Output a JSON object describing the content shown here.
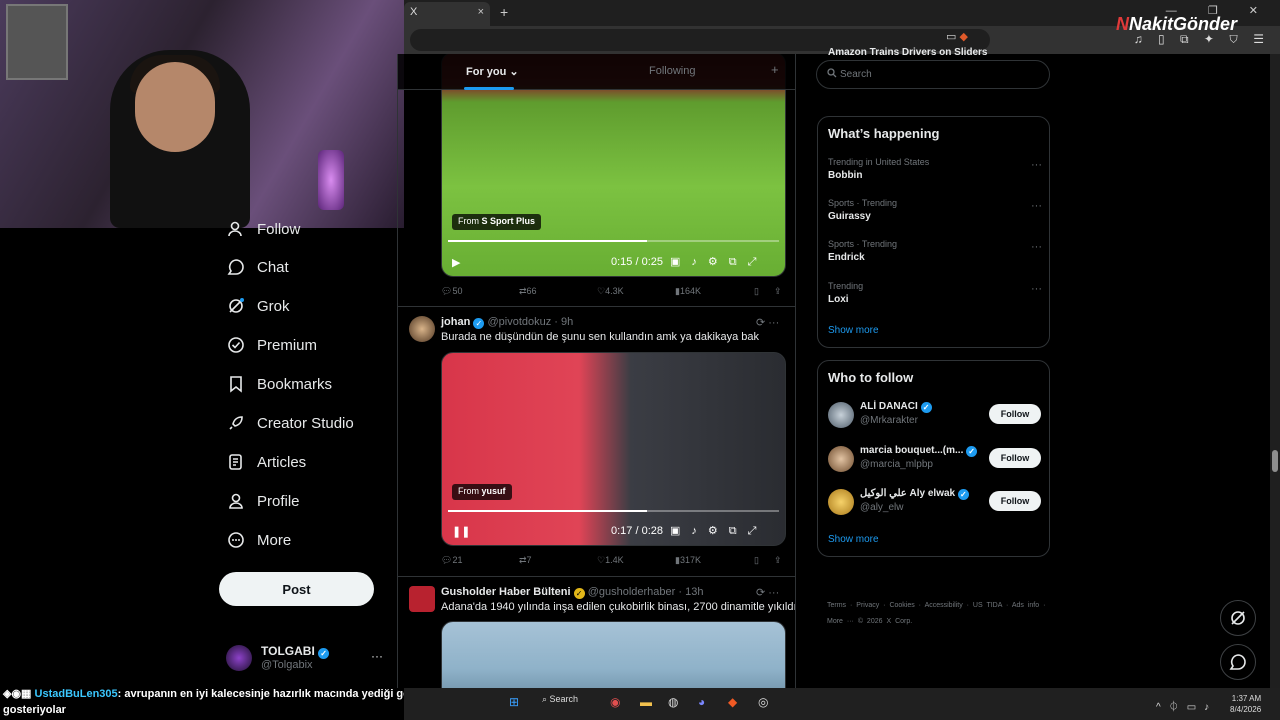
{
  "browser": {
    "tab_title": "X",
    "tab_close": "×",
    "new_tab": "+",
    "window_controls": "— ❐ ✕",
    "brand_prefix": "N",
    "brand_name": "NakitGönder"
  },
  "nav": {
    "items": [
      {
        "label": "Follow",
        "icon": "follow-icon"
      },
      {
        "label": "Chat",
        "icon": "chat-icon"
      },
      {
        "label": "Grok",
        "icon": "grok-icon"
      },
      {
        "label": "Premium",
        "icon": "premium-icon"
      },
      {
        "label": "Bookmarks",
        "icon": "bookmark-icon"
      },
      {
        "label": "Creator Studio",
        "icon": "rocket-icon"
      },
      {
        "label": "Articles",
        "icon": "articles-icon"
      },
      {
        "label": "Profile",
        "icon": "profile-icon"
      },
      {
        "label": "More",
        "icon": "more-circle-icon"
      }
    ],
    "post_label": "Post",
    "account": {
      "name": "TOLGABI",
      "handle": "@Tolgabix",
      "menu": "···"
    }
  },
  "timeline": {
    "tabs": [
      {
        "label": "For you ⌄",
        "active": true
      },
      {
        "label": "Following",
        "active": false
      }
    ],
    "add": "+",
    "tweets": [
      {
        "video": {
          "from_prefix": "From",
          "from_source": "S Sport Plus",
          "time": "0:15 / 0:25",
          "progress": 0.6,
          "control": "▶"
        },
        "stats": {
          "replies": "50",
          "reposts": "66",
          "likes": "4.3K",
          "views": "164K"
        }
      },
      {
        "name": "johan",
        "handle": "@pivotdokuz",
        "age": "· 9h",
        "text": "Burada ne düşündün de şunu sen kullandın amk ya dakikaya bak",
        "video": {
          "from_prefix": "From",
          "from_source": "yusuf",
          "time": "0:17 / 0:28",
          "progress": 0.6,
          "control": "❚❚"
        },
        "stats": {
          "replies": "21",
          "reposts": "7",
          "likes": "1.4K",
          "views": "317K"
        }
      },
      {
        "name": "Gusholder Haber Bülteni",
        "handle": "@gusholderhaber",
        "age": "· 13h",
        "text": "Adana'da 1940 yılında inşa edilen çukobirlik binası, 2700 dinamitle yıkıldı."
      }
    ]
  },
  "sidebar": {
    "top_partial": "Amazon Trains Drivers on Sliders",
    "search_placeholder": "Search",
    "happening": {
      "title": "What’s happening",
      "trends": [
        {
          "context": "Trending in United States",
          "topic": "Bobbin"
        },
        {
          "context": "Sports · Trending",
          "topic": "Guirassy"
        },
        {
          "context": "Sports · Trending",
          "topic": "Endrick"
        },
        {
          "context": "Trending",
          "topic": "Loxi"
        }
      ],
      "show_more": "Show more"
    },
    "who_to_follow": {
      "title": "Who to follow",
      "users": [
        {
          "name": "ALİ DANACI",
          "handle": "@Mrkarakter",
          "button": "Follow"
        },
        {
          "name": "marcia bouquet...(m...",
          "handle": "@marcia_mlpbp",
          "button": "Follow"
        },
        {
          "name": "علي الوكيل Aly elwak",
          "handle": "@aly_elw",
          "button": "Follow"
        }
      ],
      "show_more": "Show more"
    },
    "footer": "Terms · Privacy · Cookies · Accessibility · US TIDA · Ads info · More ··· © 2026 X Corp."
  },
  "chat_overlay": {
    "user": "UstadBuLen305",
    "message": ": avrupanın en iyi kalecesinje hazırlık macında yediği golu gosteriyolar"
  },
  "taskbar": {
    "search_label": "Search",
    "time": "1:37 AM",
    "date": "8/4/2026"
  },
  "colors": {
    "accent": "#1d9bf0",
    "background": "#000000",
    "border": "#2f3336"
  }
}
